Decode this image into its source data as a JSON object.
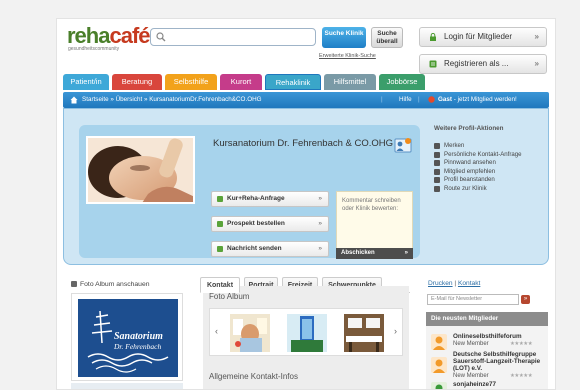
{
  "header": {
    "logo_main_a": "reha",
    "logo_main_b": "café",
    "logo_sub": "gesundheitscommunity",
    "search_placeholder": "",
    "search_clinic_btn": "Suche Klinik",
    "search_all_btn": "Suche überall",
    "advanced_search": "Erweiterte Klinik-Suche",
    "login_btn": "Login für Mitglieder",
    "register_btn": "Registrieren als ...",
    "chevron": "»"
  },
  "nav": {
    "tabs": [
      {
        "label": "Patient/in",
        "color": "#3ea8d8"
      },
      {
        "label": "Beratung",
        "color": "#d9463c"
      },
      {
        "label": "Selbsthilfe",
        "color": "#f2a21b"
      },
      {
        "label": "Kurort",
        "color": "#c53c8a"
      },
      {
        "label": "Rehaklinik",
        "color": "#3aa6c9"
      },
      {
        "label": "Hilfsmittel",
        "color": "#7a9aa6"
      },
      {
        "label": "Jobbörse",
        "color": "#3b9e6b"
      }
    ]
  },
  "breadcrumb": {
    "path": "Startseite » Übersicht » KursanatoriumDr.Fehrenbach&CO.OHG",
    "help": "Hilfe",
    "guest": "Gast",
    "guest_suffix": " - jetzt Mitglied werden!"
  },
  "profile": {
    "name": "Kursanatorium Dr. Fehrenbach & CO.OHG",
    "actions": [
      {
        "label": "Kur+Reha-Anfrage"
      },
      {
        "label": "Prospekt bestellen"
      },
      {
        "label": "Nachricht senden"
      }
    ],
    "arrow": "»",
    "comment_placeholder": "Kommentar schreiben oder Klinik bewerten:",
    "send_label": "Abschicken",
    "more_title": "Weitere Profil-Aktionen",
    "more_items": [
      "Merken",
      "Persönliche Kontakt-Anfrage",
      "Pinnwand ansehen",
      "Mitglied empfehlen",
      "Profil beanstanden",
      "Route zur Klinik"
    ]
  },
  "content": {
    "album_link": "Foto Album anschauen",
    "tabs": [
      "Kontakt",
      "Portrait",
      "Freizeit",
      "Schwerpunkte"
    ],
    "photo_album_title": "Foto Album",
    "contact_title": "Allgemeine Kontakt-Infos",
    "logo_line1": "Sanatorium",
    "logo_line2": "Dr. Fehrenbach",
    "prev": "‹",
    "next": "›"
  },
  "right": {
    "print": "Drucken",
    "separator": "|",
    "contact": "Kontakt",
    "newsletter_placeholder": "E-Mail für Newsletter",
    "newsletter_btn": "»",
    "members_title": "Die neusten Mitglieder",
    "members": [
      {
        "name": "Onlineselbsthilfeforum",
        "role": "New Member",
        "stars": "★★★★★"
      },
      {
        "name": "Deutsche Selbsthilfegruppe Sauerstoff-Langzeit-Therapie (LOT) e.V.",
        "role": "New Member",
        "stars": "★★★★★"
      },
      {
        "name": "sonjaheinze77",
        "role": "New Member",
        "stars": "★★★★★"
      }
    ]
  }
}
